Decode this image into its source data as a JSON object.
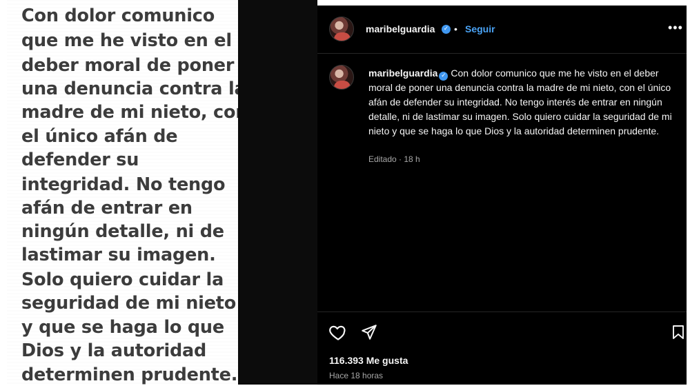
{
  "post_image": {
    "lines": [
      "Con dolor comunico",
      "que me he visto en el",
      "deber moral de poner",
      "una denuncia contra la",
      "madre de mi nieto, con",
      "el único afán de",
      "defender su",
      "integridad.  No tengo",
      "afán de entrar en",
      "ningún detalle, ni de",
      "lastimar su imagen.",
      "Solo quiero cuidar la",
      "seguridad de mi nieto",
      "y que se haga lo que",
      "Dios y la autoridad",
      "determinen prudente."
    ]
  },
  "header": {
    "username": "maribelguardia",
    "verified_icon": "✓",
    "separator": "•",
    "follow_label": "Seguir",
    "more_label": "•••"
  },
  "caption": {
    "username": "maribelguardia",
    "text": "Con dolor comunico que me he visto en el deber moral de poner una denuncia contra la madre de mi nieto, con el único afán de defender su integridad. No tengo interés de entrar en ningún detalle, ni de lastimar su imagen. Solo quiero cuidar la seguridad de mi nieto y que se haga lo que Dios y la autoridad determinen prudente.",
    "meta": "Editado · 18 h"
  },
  "actions": {
    "icons": [
      "heart-icon",
      "send-icon",
      "bookmark-icon"
    ]
  },
  "footer": {
    "likes": "116.393 Me gusta",
    "time_ago": "Hace 18 horas"
  },
  "colors": {
    "background": "#000000",
    "text": "#f5f5f5",
    "muted": "#a8a8a8",
    "link": "#4aa3f5",
    "verified": "#3f97f0"
  }
}
